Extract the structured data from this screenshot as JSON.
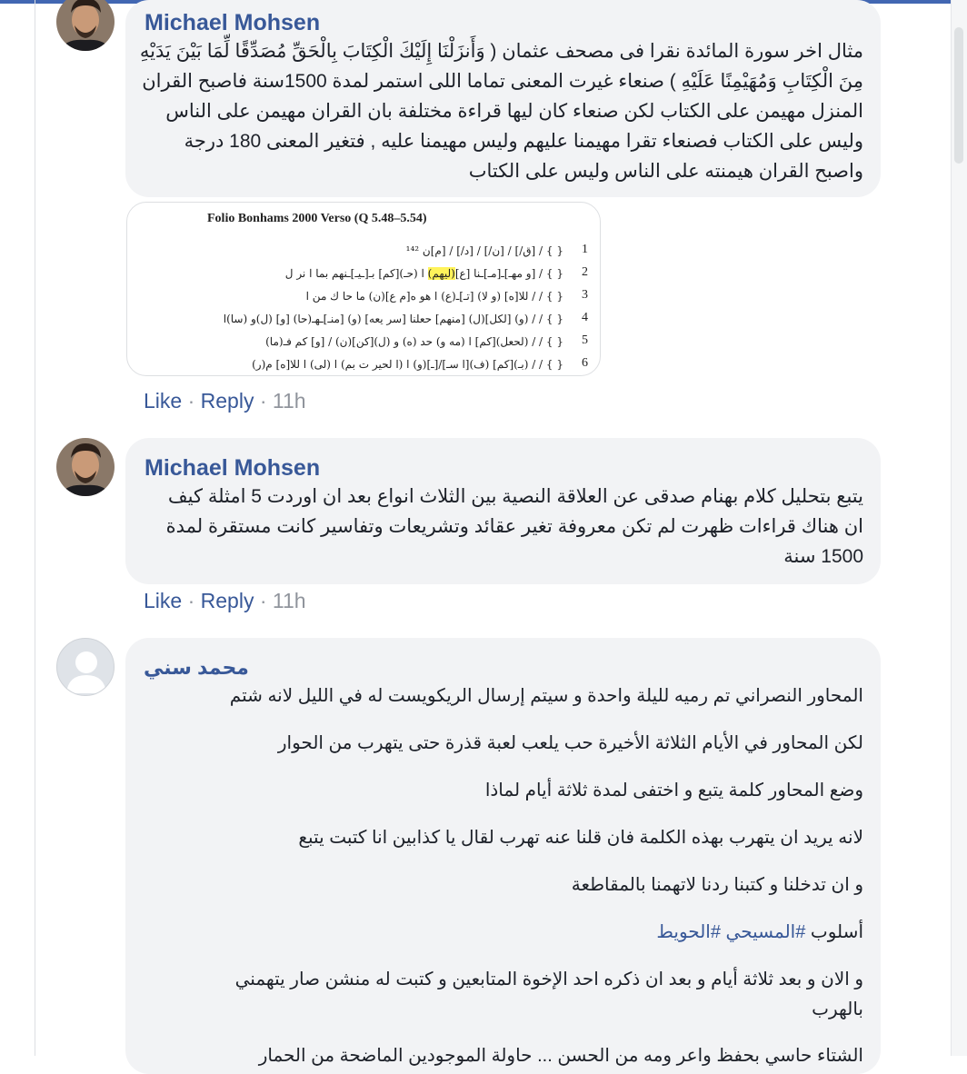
{
  "comments": [
    {
      "author": "Michael Mohsen",
      "text": "مثال اخر سورة المائدة نقرا فى مصحف عثمان ( وَأَنزَلْنَا إِلَيْكَ الْكِتَابَ بِالْحَقِّ مُصَدِّقًا لِّمَا بَيْنَ يَدَيْهِ\nمِنَ الْكِتَابِ وَمُهَيْمِنًا عَلَيْهِ ) صنعاء غيرت المعنى تماما اللى استمر لمدة 1500سنة فاصبح القران\nالمنزل مهيمن على الكتاب لكن صنعاء كان ليها قراءة مختلفة بان القران مهيمن على الناس\nوليس على الكتاب فصنعاء تقرا مهيمنا عليهم وليس مهيمنا عليه , فتغير المعنى 180 درجة\nواصبح القران هيمنته على الناس وليس على الكتاب",
      "attachment": {
        "title": "Folio Bonhams 2000 Verso (Q 5.48–5.54)",
        "lines": [
          {
            "num": "1",
            "text": "{ }   /   [ق/]   /   [ن/] / [د/] / [م]ن ¹⁴²",
            "highlight": ""
          },
          {
            "num": "2",
            "text": "{ }  /  [و مهـ]ـ[مـ]ـنا [ع]",
            "highlight": "(ليهم)",
            "rest": "ا (حـ)[كم] بـ[ـيـ]ـنهم بما ا نر ل"
          },
          {
            "num": "3",
            "text": "{ } / / للا[ه] (و لا) [تـ]ـ(ع) ا هو ه[م ع](ن) ما حا ك من ا",
            "highlight": ""
          },
          {
            "num": "4",
            "text": "{ } / / (و) [لكل](ل) [منهم] حعلنا [سر يعه] (و) [منـ]ـهـ(حا) [و] (ل)و (سا)ا",
            "highlight": ""
          },
          {
            "num": "5",
            "text": "{ } / / (لحعل)[كم] ا (مه و) حد (ه) و (ل)[كن](ن) / [و] كم فـ(ما)",
            "highlight": ""
          },
          {
            "num": "6",
            "text": "{ } / / (بـ)[كم] (ف)[ا سـ]/[ـ](و) ا (ا لحير ت بم) ا (لى) ا للا[ه] م(ر)",
            "highlight": ""
          }
        ]
      },
      "actions": {
        "like": "Like",
        "reply": "Reply",
        "sep": "·",
        "time": "11h"
      }
    },
    {
      "author": "Michael Mohsen",
      "text": "يتبع بتحليل كلام بهنام صدقى عن العلاقة النصية بين الثلاث انواع بعد ان اوردت 5 امثلة كيف\nان هناك قراءات ظهرت لم تكن معروفة تغير عقائد وتشريعات وتفاسير كانت مستقرة لمدة\n1500 سنة",
      "actions": {
        "like": "Like",
        "reply": "Reply",
        "sep": "·",
        "time": "11h"
      }
    },
    {
      "author": "محمد سني",
      "paragraphs": [
        "المحاور النصراني تم رميه لليلة واحدة و سيتم إرسال الريكويست له في الليل لانه شتم",
        "لكن المحاور في الأيام الثلاثة الأخيرة حب يلعب لعبة قذرة حتى يتهرب من الحوار",
        "وضع المحاور كلمة يتبع و اختفى لمدة ثلاثة أيام لماذا",
        "لانه يريد ان يتهرب بهذه الكلمة فان قلنا عنه تهرب لقال يا كذابين انا كتبت يتبع",
        "و ان تدخلنا و كتبنا ردنا لاتهمنا بالمقاطعة"
      ],
      "hashtag_line": {
        "prefix": "أسلوب ",
        "tag1": "#المسيحي",
        "tag2": " #الحويط"
      },
      "paragraph_after": "و الان و بعد ثلاثة أيام و بعد ان ذكره احد الإخوة المتابعين و كتبت له منشن صار يتهمني بالهرب",
      "paragraph_cut": "الشتاء حاسي بحفظ واعر ومه من الحسن ... حاولة الموجودين الماضحة من الحمار"
    }
  ]
}
